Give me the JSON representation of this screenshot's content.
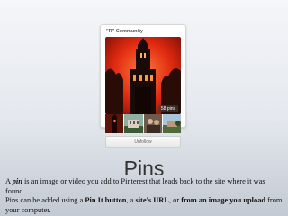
{
  "board": {
    "title": "\"R\" Community",
    "pin_count": "58 pins",
    "unfollow_label": "Unfollow"
  },
  "slide": {
    "heading": "Pins",
    "para1": {
      "pre": "A ",
      "pin_word": "pin",
      "post": " is an image or video you add to Pinterest that leads back to the site where it was found."
    },
    "para2": {
      "pre": "Pins can be added using a ",
      "b1": "Pin It button",
      "m1": ", a ",
      "b2": "site's URL",
      "m2": ", or ",
      "b3": "from an image you upload",
      "post": " from your computer."
    }
  },
  "colors": {
    "cover_sky": "#e02a10",
    "cover_building": "#1a0b08"
  }
}
